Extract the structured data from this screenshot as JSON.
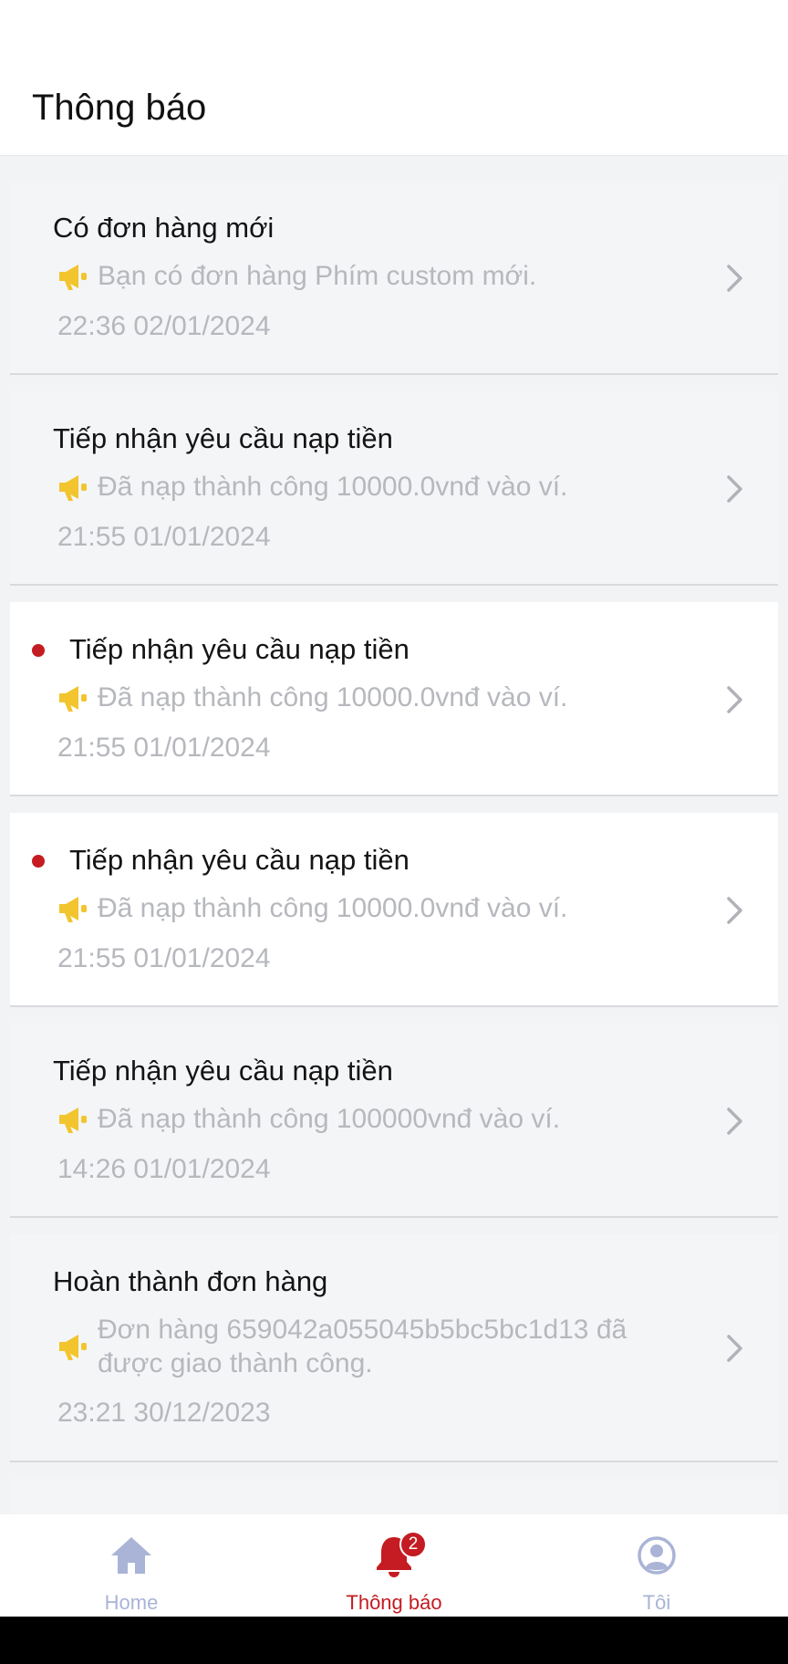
{
  "header": {
    "title": "Thông báo"
  },
  "colors": {
    "accent": "#c41c22",
    "muted": "#b6b8bd",
    "megaphone": "#f2c52e",
    "tab_inactive": "#a9b4d6"
  },
  "notifications": [
    {
      "title": "Có đơn hàng mới",
      "message": "Bạn có đơn hàng Phím custom mới.",
      "time": "22:36 02/01/2024",
      "unread": false
    },
    {
      "title": "Tiếp nhận yêu cầu nạp tiền",
      "message": "Đã nạp thành công 10000.0vnđ vào ví.",
      "time": "21:55 01/01/2024",
      "unread": false
    },
    {
      "title": "Tiếp nhận yêu cầu nạp tiền",
      "message": "Đã nạp thành công 10000.0vnđ vào ví.",
      "time": "21:55 01/01/2024",
      "unread": true
    },
    {
      "title": "Tiếp nhận yêu cầu nạp tiền",
      "message": "Đã nạp thành công 10000.0vnđ vào ví.",
      "time": "21:55 01/01/2024",
      "unread": true
    },
    {
      "title": "Tiếp nhận yêu cầu nạp tiền",
      "message": "Đã nạp thành công 100000vnđ vào ví.",
      "time": "14:26 01/01/2024",
      "unread": false
    },
    {
      "title": "Hoàn thành đơn hàng",
      "message": "Đơn hàng 659042a055045b5bc5bc1d13 đã được giao thành công.",
      "time": "23:21 30/12/2023",
      "unread": false
    }
  ],
  "tabbar": {
    "items": [
      {
        "label": "Home",
        "icon": "home-icon",
        "active": false
      },
      {
        "label": "Thông báo",
        "icon": "bell-icon",
        "active": true,
        "badge": "2"
      },
      {
        "label": "Tôi",
        "icon": "user-circle-icon",
        "active": false
      }
    ]
  }
}
